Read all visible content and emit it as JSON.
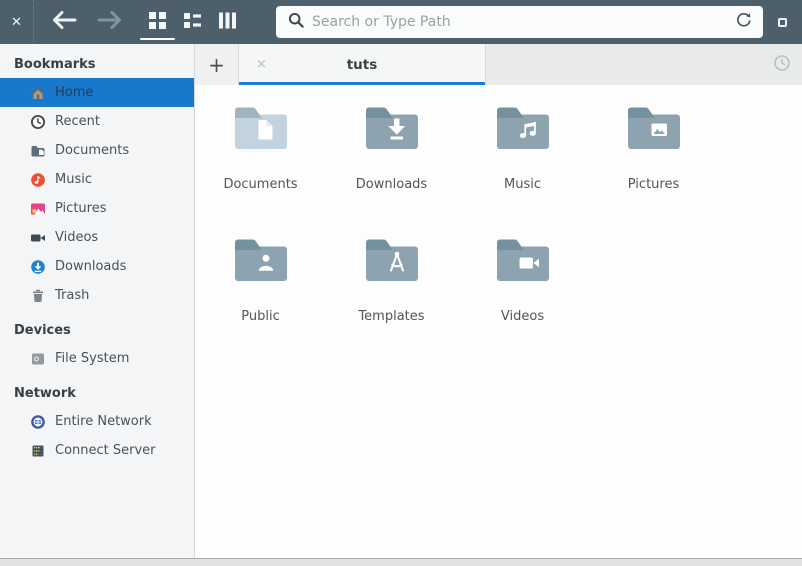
{
  "colors": {
    "accent_blue": "#1878cc",
    "tab_underline_blue": "#1a7ed6",
    "toolbar_bg": "#4d5f6a",
    "folder_body": "#8da3af",
    "folder_tab": "#75909e",
    "folder_body_light": "#c2d2de",
    "folder_tab_light": "#9fb4c0"
  },
  "toolbar": {
    "close_label": "✕",
    "search_placeholder": "Search or Type Path",
    "icon_names": [
      "close-icon",
      "back-icon",
      "forward-icon",
      "grid-view-icon",
      "list-view-icon",
      "compact-view-icon",
      "search-icon",
      "refresh-icon",
      "menu-icon"
    ],
    "active_view": "grid"
  },
  "tabbar": {
    "new_tab_label": "+",
    "history_icon": "clock-outline",
    "tabs": [
      {
        "title": "tuts",
        "close_label": "×",
        "active": true
      }
    ]
  },
  "sidebar": {
    "sections": [
      {
        "header": "Bookmarks",
        "items": [
          {
            "label": "Home",
            "icon": "home-icon",
            "selected": true
          },
          {
            "label": "Recent",
            "icon": "recent-icon",
            "selected": false
          },
          {
            "label": "Documents",
            "icon": "documents-icon",
            "selected": false
          },
          {
            "label": "Music",
            "icon": "music-icon",
            "selected": false
          },
          {
            "label": "Pictures",
            "icon": "pictures-icon",
            "selected": false
          },
          {
            "label": "Videos",
            "icon": "videos-icon",
            "selected": false
          },
          {
            "label": "Downloads",
            "icon": "downloads-icon",
            "selected": false
          },
          {
            "label": "Trash",
            "icon": "trash-icon",
            "selected": false
          }
        ]
      },
      {
        "header": "Devices",
        "items": [
          {
            "label": "File System",
            "icon": "filesystem-icon",
            "selected": false
          }
        ]
      },
      {
        "header": "Network",
        "items": [
          {
            "label": "Entire Network",
            "icon": "entire-network-icon",
            "selected": false
          },
          {
            "label": "Connect Server",
            "icon": "connect-server-icon",
            "selected": false
          }
        ]
      }
    ]
  },
  "content": {
    "folders": [
      {
        "name": "Documents",
        "glyph": "document",
        "variant": "light"
      },
      {
        "name": "Downloads",
        "glyph": "download",
        "variant": "default"
      },
      {
        "name": "Music",
        "glyph": "music-note",
        "variant": "default"
      },
      {
        "name": "Pictures",
        "glyph": "image",
        "variant": "default"
      },
      {
        "name": "Public",
        "glyph": "person",
        "variant": "default"
      },
      {
        "name": "Templates",
        "glyph": "compass",
        "variant": "default"
      },
      {
        "name": "Videos",
        "glyph": "camera",
        "variant": "default"
      }
    ]
  }
}
